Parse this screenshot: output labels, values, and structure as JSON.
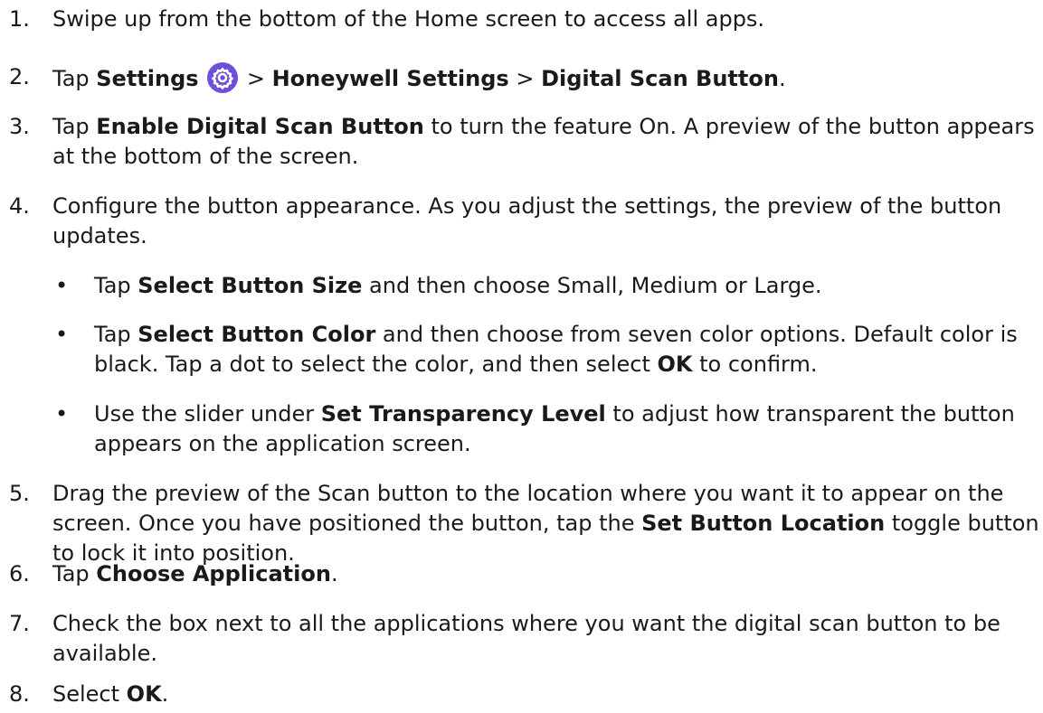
{
  "accent_color": "#6f4fd8",
  "steps": [
    {
      "num": "1.",
      "text": "Swipe up from the bottom of the Home screen to access all apps."
    },
    {
      "num": "2.",
      "t1": "Tap ",
      "b1": "Settings",
      "sep1": " > ",
      "b2": "Honeywell Settings",
      "sep2": " > ",
      "b3": "Digital Scan Button",
      "end": ".",
      "icon": "gear-icon"
    },
    {
      "num": "3.",
      "t1": "Tap ",
      "b1": "Enable Digital Scan Button",
      "t2": " to turn the feature On. A preview of the button appears at the bottom of the screen."
    },
    {
      "num": "4.",
      "text": "Configure the button appearance. As you adjust the settings, the preview of the button updates.",
      "bullets": [
        {
          "t1": "Tap ",
          "b1": "Select Button Size",
          "t2": " and then choose Small, Medium or Large."
        },
        {
          "t1": "Tap ",
          "b1": "Select Button Color",
          "t2": " and then choose from seven color options. Default color is black. Tap a dot to select the color, and then select ",
          "b2": "OK",
          "t3": " to confirm."
        },
        {
          "t1": "Use the slider under ",
          "b1": "Set Transparency Level",
          "t2": " to adjust how transparent the button appears on the application screen."
        }
      ]
    },
    {
      "num": "5.",
      "t1": "Drag the preview of the Scan button to the location where you want it to appear on the screen. Once you have positioned the button, tap the ",
      "b1": "Set Button Location",
      "t2": " toggle button to lock it into position."
    },
    {
      "num": "6.",
      "t1": "Tap ",
      "b1": "Choose Application",
      "end": "."
    },
    {
      "num": "7.",
      "text": "Check the box next to all the applications where you want the digital scan button to be available."
    },
    {
      "num": "8.",
      "t1": "Select ",
      "b1": "OK",
      "end": "."
    }
  ],
  "bullet_glyph": "•"
}
